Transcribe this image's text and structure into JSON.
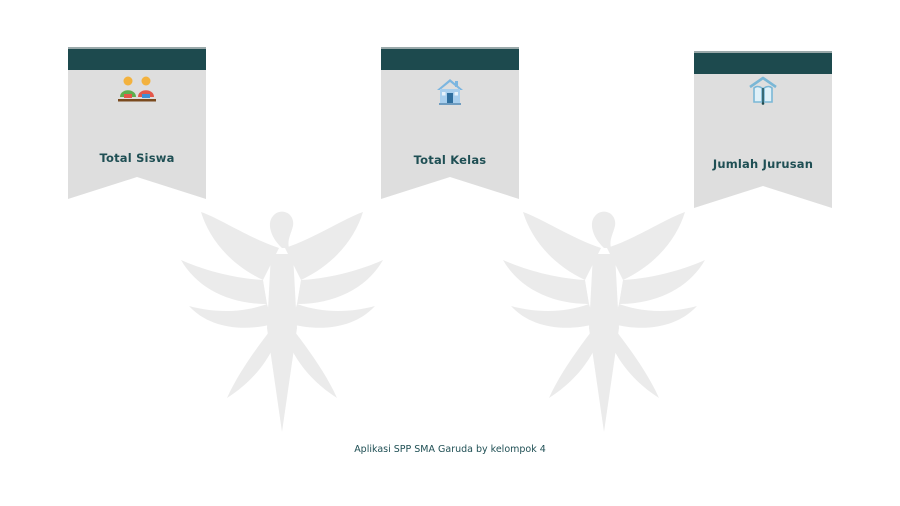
{
  "cards": [
    {
      "label": "Total Siswa",
      "icon": "students-icon"
    },
    {
      "label": "Total Kelas",
      "icon": "house-icon"
    },
    {
      "label": "Jumlah Jurusan",
      "icon": "book-icon"
    }
  ],
  "footer": {
    "text": "Aplikasi SPP SMA Garuda by kelompok 4"
  },
  "colors": {
    "header_bar": "#1d4a4e",
    "card_background": "#dedede",
    "text": "#1f4f54",
    "watermark": "#e9e9e9"
  }
}
